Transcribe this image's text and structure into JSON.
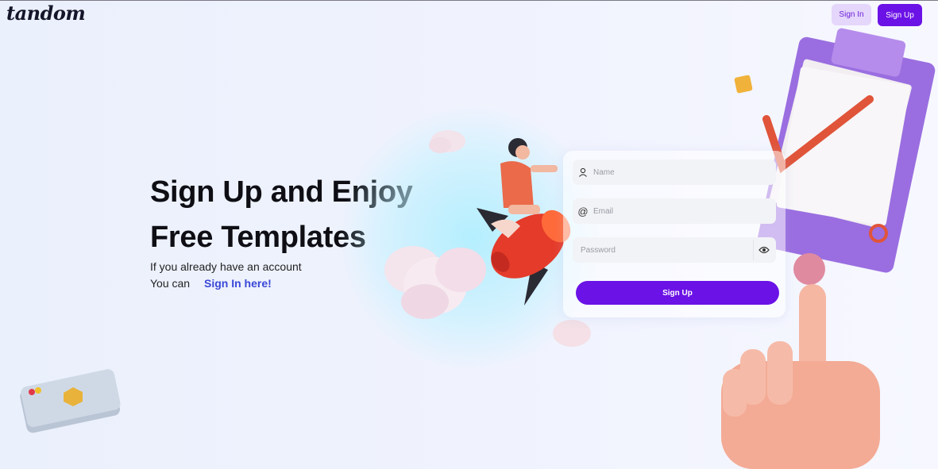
{
  "header": {
    "logo": "tandom",
    "signin_label": "Sign In",
    "signup_label": "Sign Up"
  },
  "hero": {
    "headline_line1": "Sign Up and Enjoy",
    "headline_line2": "Free Templates",
    "subtext_line1": "If you already have an account",
    "subtext_prefix": "You can",
    "signin_link": "Sign In here!"
  },
  "form": {
    "name_placeholder": "Name",
    "email_placeholder": "Email",
    "password_placeholder": "Password",
    "submit_label": "Sign Up"
  },
  "icons": {
    "name": "user-icon",
    "email": "at-icon",
    "password": "eye-icon"
  },
  "colors": {
    "accent": "#6b12e6",
    "accent_light": "#e5d6fb",
    "link": "#3a48d8"
  }
}
